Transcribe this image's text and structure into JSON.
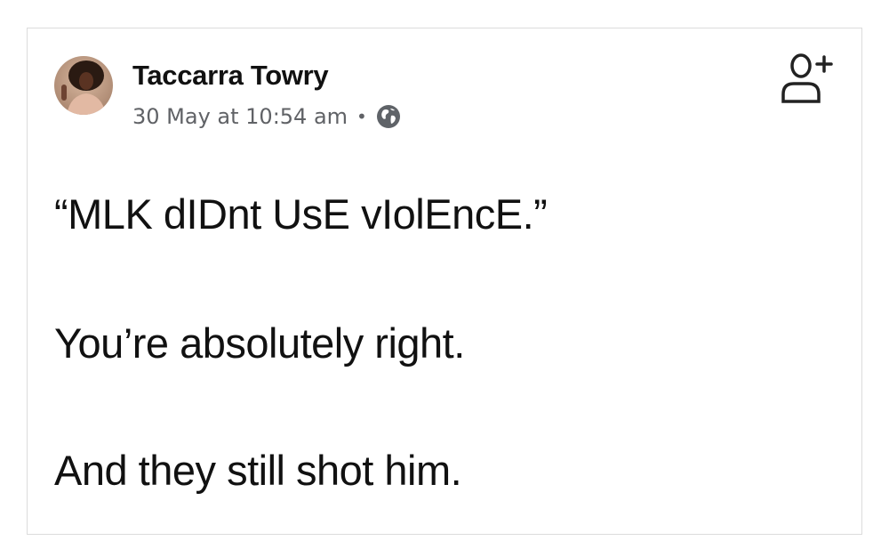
{
  "post": {
    "author": "Taccarra Towry",
    "timestamp": "30 May at 10:54 am",
    "separator": "•",
    "privacy_icon": "globe-icon",
    "action_icon": "add-friend-icon",
    "lines": [
      "“MLK dIDnt UsE vIolEncE.”",
      "You’re absolutely right.",
      "And they still shot him."
    ]
  },
  "colors": {
    "text": "#111111",
    "meta": "#606266",
    "border": "#dcdcdc"
  }
}
